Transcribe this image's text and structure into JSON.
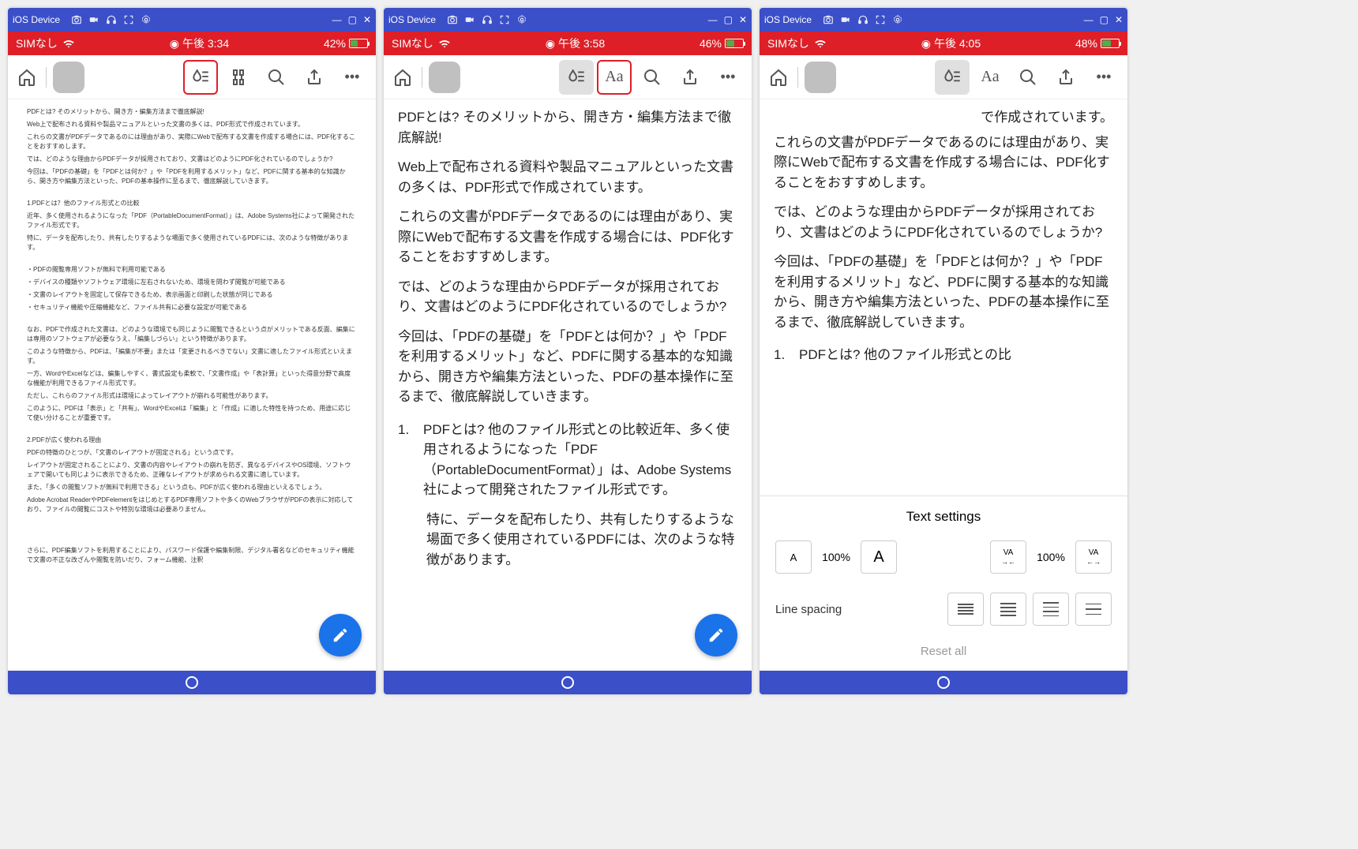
{
  "titlebar": {
    "title": "iOS Device",
    "icons": {
      "camera": "📷",
      "video": "🎥",
      "headset": "🎧",
      "expand": "⛶",
      "gear": "⚙"
    },
    "window": {
      "min": "—",
      "max": "▢",
      "close": "✕"
    }
  },
  "devices": [
    {
      "status": {
        "sim": "SIMなし",
        "time": "午後 3:34",
        "battery": "42%",
        "battery_pct": 42
      },
      "highlight_btn": "liquid",
      "active_btn": null,
      "view": "small",
      "fab": true,
      "settings": false
    },
    {
      "status": {
        "sim": "SIMなし",
        "time": "午後 3:58",
        "battery": "46%",
        "battery_pct": 46
      },
      "highlight_btn": "text",
      "active_btn": "liquid",
      "view": "big",
      "fab": true,
      "settings": false
    },
    {
      "status": {
        "sim": "SIMなし",
        "time": "午後 4:05",
        "battery": "48%",
        "battery_pct": 48
      },
      "highlight_btn": null,
      "active_btn": "liquid",
      "view": "big2",
      "fab": false,
      "settings": true
    }
  ],
  "toolbar_icons": {
    "text_label": "Aa",
    "more": "•••"
  },
  "small_content": {
    "title": "PDFとは? そのメリットから、開き方・編集方法まで徹底解説!",
    "p1": "Web上で配布される資料や製品マニュアルといった文書の多くは、PDF形式で作成されています。",
    "p2": "これらの文書がPDFデータであるのには理由があり、実際にWebで配布する文書を作成する場合には、PDF化することをおすすめします。",
    "p3": "では、どのような理由からPDFデータが採用されており、文書はどのようにPDF化されているのでしょうか?",
    "p4": "今回は、「PDFの基礎」を「PDFとは何か？」や「PDFを利用するメリット」など、PDFに関する基本的な知識から、開き方や編集方法といった、PDFの基本操作に至るまで、徹底解説していきます。",
    "h1": "1.PDFとは？他のファイル形式との比較",
    "p5": "近年、多く使用されるようになった「PDF（PortableDocumentFormat）」は、Adobe Systems社によって開発されたファイル形式です。",
    "p6": "特に、データを配布したり、共有したりするような場面で多く使用されているPDFには、次のような特徴があります。",
    "b1": "・PDFの閲覧専用ソフトが無料で利用可能である",
    "b2": "・デバイスの種類やソフトウェア環境に左右されないため、環境を問わず閲覧が可能である",
    "b3": "・文書のレイアウトを固定して保存できるため、表示画面と印刷した状態が同じである",
    "b4": "・セキュリティ機能や圧縮機能など、ファイル共有に必要な設定が可能である",
    "p7": "なお、PDFで作成された文書は、どのような環境でも同じように閲覧できるという点がメリットである反面、編集には専用のソフトウェアが必要なうえ、「編集しづらい」という特徴があります。",
    "p8": "このような特徴から、PDFは、「編集が不要」または「変更されるべきでない」文書に適したファイル形式といえます。",
    "p9": "一方、WordやExcelなどは、編集しやすく、書式設定も柔軟で、「文書作成」や「表計算」といった得意分野で高度な機能が利用できるファイル形式です。",
    "p10": "ただし、これらのファイル形式は環境によってレイアウトが崩れる可能性があります。",
    "p11": "このように、PDFは「表示」と「共有」、WordやExcelは「編集」と「作成」に適した特性を持つため、用途に応じて使い分けることが重要です。",
    "h2": "2.PDFが広く使われる理由",
    "p12": "PDFの特徴のひとつが、「文書のレイアウトが固定される」という点です。",
    "p13": "レイアウトが固定されることにより、文書の内容やレイアウトの崩れを防ぎ、異なるデバイスやOS環境、ソフトウェアで開いても同じように表示できるため、正確なレイアウトが求められる文書に適しています。",
    "p14": "また、「多くの閲覧ソフトが無料で利用できる」という点も、PDFが広く使われる理由といえるでしょう。",
    "p15": "Adobe Acrobat ReaderやPDFelementをはじめとするPDF専用ソフトや多くのWebブラウザがPDFの表示に対応しており、ファイルの閲覧にコストや特別な環境は必要ありません。",
    "footer": "さらに、PDF編集ソフトを利用することにより、パスワード保護や編集制限、デジタル署名などのセキュリティ機能で文書の不正な改ざんや閲覧を防いだり、フォーム機能、注釈"
  },
  "big_content": {
    "title": "PDFとは? そのメリットから、開き方・編集方法まで徹底解説!",
    "p1": "Web上で配布される資料や製品マニュアルといった文書の多くは、PDF形式で作成されています。",
    "p2": "これらの文書がPDFデータであるのには理由があり、実際にWebで配布する文書を作成する場合には、PDF化することをおすすめします。",
    "p3": "では、どのような理由からPDFデータが採用されており、文書はどのようにPDF化されているのでしょうか?",
    "p4": "今回は、「PDFの基礎」を「PDFとは何か？」や「PDFを利用するメリット」など、PDFに関する基本的な知識から、開き方や編集方法といった、PDFの基本操作に至るまで、徹底解説していきます。",
    "list_num": "1.",
    "list_text": "PDFとは? 他のファイル形式との比較近年、多く使用されるようになった「PDF（PortableDocumentFormat）」は、Adobe Systems社によって開発されたファイル形式です。",
    "p5": "特に、データを配布したり、共有したりするような場面で多く使用されているPDFには、次のような特徴があります。"
  },
  "big2_content": {
    "p0": "で作成されています。",
    "p1": "これらの文書がPDFデータであるのには理由があり、実際にWebで配布する文書を作成する場合には、PDF化することをおすすめします。",
    "p2": "では、どのような理由からPDFデータが採用されており、文書はどのようにPDF化されているのでしょうか?",
    "p3": "今回は、「PDFの基礎」を「PDFとは何か？」や「PDFを利用するメリット」など、PDFに関する基本的な知識から、開き方や編集方法といった、PDFの基本操作に至るまで、徹底解説していきます。",
    "list_num": "1.",
    "list_text": "PDFとは? 他のファイル形式との比"
  },
  "text_settings": {
    "title": "Text settings",
    "small_a": "A",
    "size_pct": "100%",
    "big_a": "A",
    "va_in": "VA",
    "space_pct": "100%",
    "va_out": "VA",
    "line_spacing_label": "Line spacing",
    "reset": "Reset all"
  }
}
